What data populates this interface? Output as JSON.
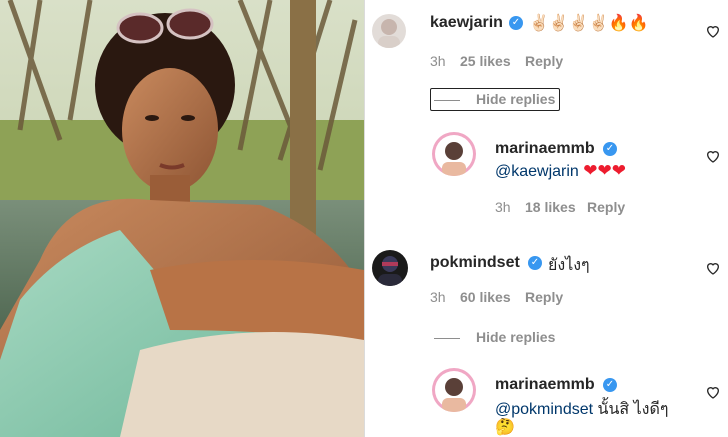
{
  "comments": [
    {
      "username": "kaewjarin",
      "text": "✌🏻✌🏻✌🏻✌🏻🔥🔥",
      "time": "3h",
      "likes": "25 likes",
      "reply": "Reply",
      "hide_replies": "Hide replies"
    },
    {
      "username": "marinaemmb",
      "mention": "@kaewjarin",
      "text": "❤❤❤",
      "time": "3h",
      "likes": "18 likes",
      "reply": "Reply"
    },
    {
      "username": "pokmindset",
      "text": "ยังไงๆ",
      "time": "3h",
      "likes": "60 likes",
      "reply": "Reply",
      "hide_replies": "Hide replies"
    },
    {
      "username": "marinaemmb",
      "mention": "@pokmindset",
      "text": "นั้นสิ ไงดีๆ",
      "emoji": "🤔"
    }
  ],
  "colors": {
    "verified": "#3897f0",
    "mention": "#00376b",
    "heart": "#ed1c2e",
    "meta": "#8e8e8e"
  },
  "icons": {
    "like": "heart-outline-icon",
    "verified": "verified-badge-icon"
  }
}
